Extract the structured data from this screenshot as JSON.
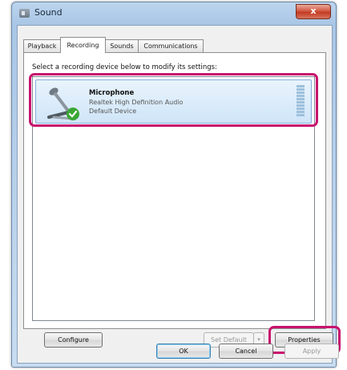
{
  "window": {
    "title": "Sound",
    "close_label": "x"
  },
  "tabs": [
    {
      "label": "Playback",
      "active": false
    },
    {
      "label": "Recording",
      "active": true
    },
    {
      "label": "Sounds",
      "active": false
    },
    {
      "label": "Communications",
      "active": false
    }
  ],
  "recording": {
    "instruction": "Select a recording device below to modify its settings:",
    "devices": [
      {
        "name": "Microphone",
        "description": "Realtek High Definition Audio",
        "status": "Default Device",
        "icon": "microphone-icon",
        "status_icon": "checkmark-icon"
      }
    ]
  },
  "buttons": {
    "configure": "Configure",
    "set_default": "Set Default",
    "set_default_dropdown": "▾",
    "properties": "Properties",
    "ok": "OK",
    "cancel": "Cancel",
    "apply": "Apply"
  },
  "colors": {
    "highlight": "#c8136e",
    "selection": "#cfe5f8",
    "status_green": "#3aa635"
  }
}
